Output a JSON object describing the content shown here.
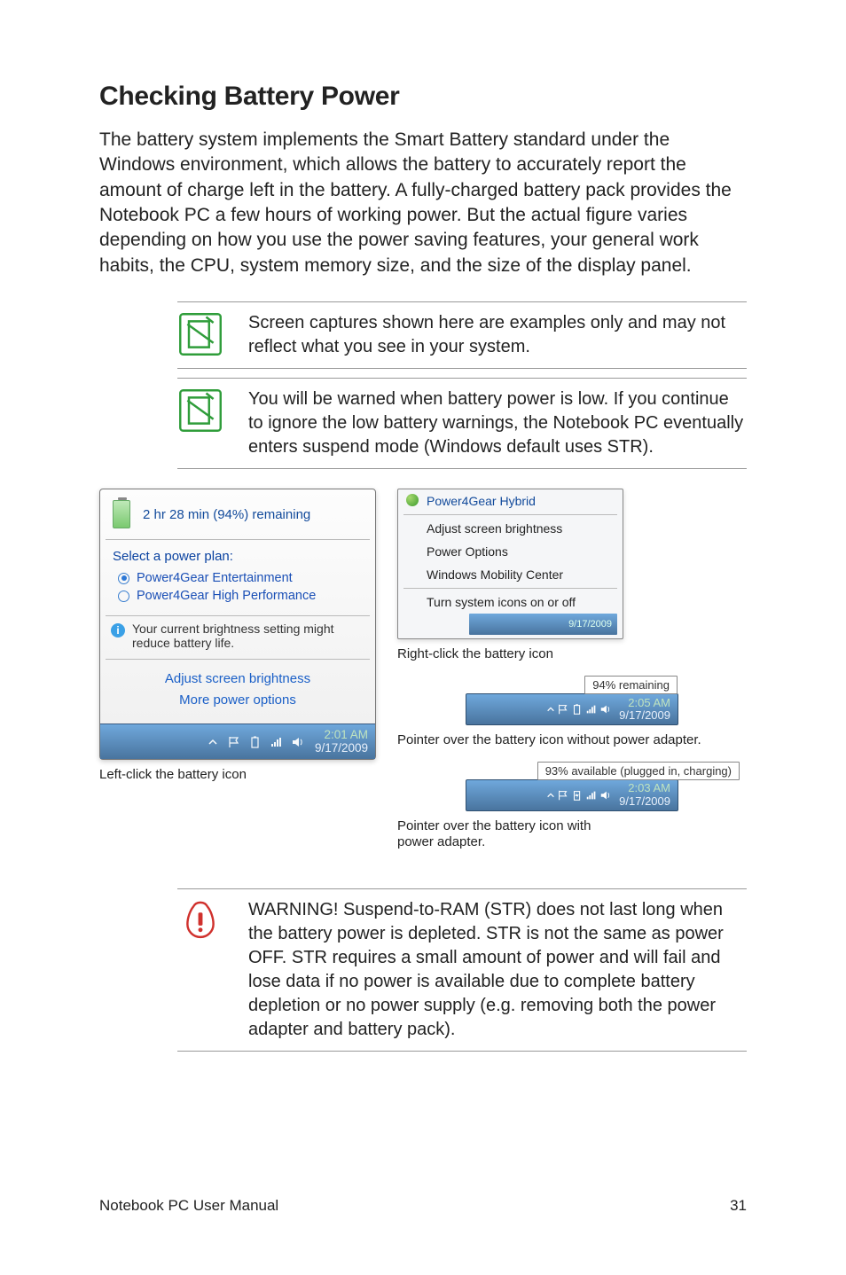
{
  "section_title": "Checking Battery Power",
  "intro": "The battery system implements the Smart Battery standard under the Windows environment, which allows the battery to accurately report the amount of charge left in the battery. A fully-charged battery pack provides the Notebook PC a few hours of working power. But the actual figure varies depending on how you use the power saving features, your general work habits, the CPU, system memory size, and the size of the display panel.",
  "note1": "Screen captures shown here are examples only and may not reflect what you see in your system.",
  "note2": "You will be warned when battery power is low. If you continue to ignore the low battery warnings, the Notebook PC eventually enters suspend mode (Windows default uses STR).",
  "flyout": {
    "remaining": "2 hr 28 min (94%) remaining",
    "select_plan": "Select a power plan:",
    "plan1": "Power4Gear Entertainment",
    "plan2": "Power4Gear High Performance",
    "brightness_msg": "Your current brightness setting might reduce battery life.",
    "adjust": "Adjust screen brightness",
    "more": "More power options"
  },
  "taskbar1": {
    "time": "2:01 AM",
    "date": "9/17/2009"
  },
  "caption_left": "Left-click the battery icon",
  "rc_menu": {
    "title": "Power4Gear Hybrid",
    "item1": "Adjust screen brightness",
    "item2": "Power Options",
    "item3": "Windows Mobility Center",
    "item4": "Turn system icons on or off",
    "ts_date": "9/17/2009"
  },
  "caption_rc": "Right-click the battery icon",
  "tooltip1": "94% remaining",
  "taskbar2": {
    "time": "2:05 AM",
    "date": "9/17/2009"
  },
  "caption_tip1": "Pointer over the battery icon without power adapter.",
  "tooltip2": "93% available (plugged in, charging)",
  "taskbar3": {
    "time": "2:03 AM",
    "date": "9/17/2009"
  },
  "caption_tip2": "Pointer over the battery icon with power adapter.",
  "warning": "WARNING!  Suspend-to-RAM (STR) does not last long when the battery power is depleted. STR is not the same as power OFF. STR requires a small amount of power and will fail and lose data if no power is available due to complete battery depletion or no power supply (e.g. removing both the power adapter and battery pack).",
  "footer_left": "Notebook PC User Manual",
  "footer_right": "31"
}
